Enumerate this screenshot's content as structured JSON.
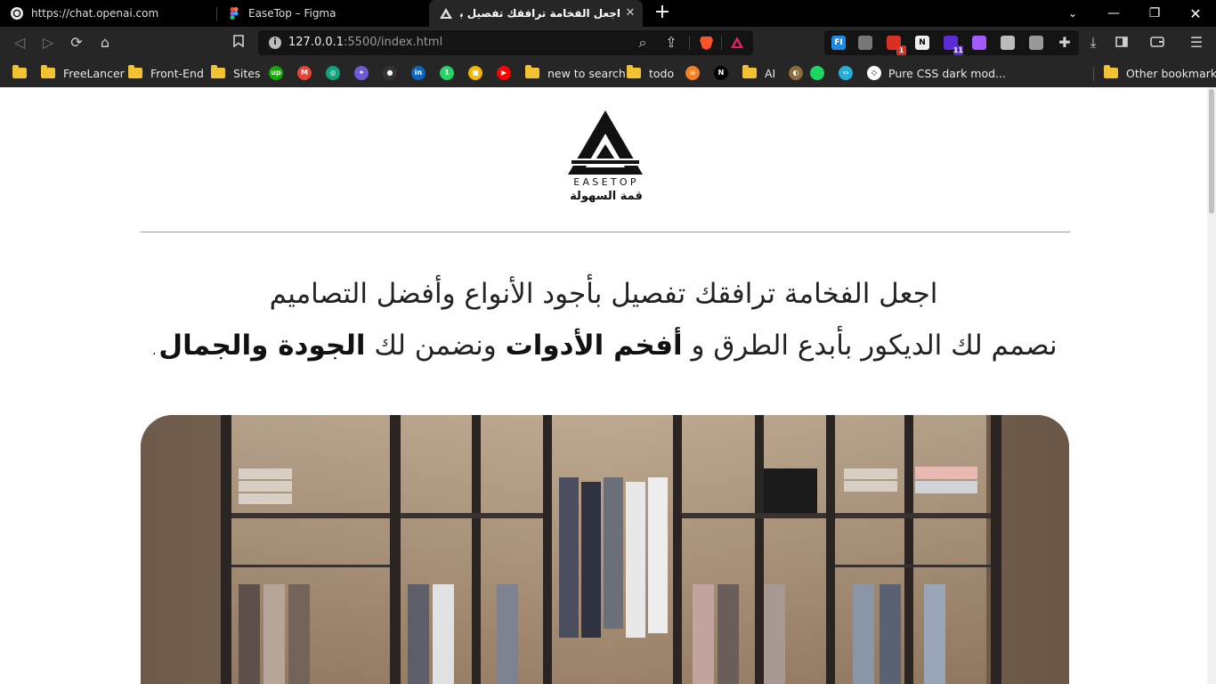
{
  "browser": {
    "tabs": [
      {
        "title": "https://chat.openai.com",
        "active": false,
        "icon": "openai-icon"
      },
      {
        "title": "EaseTop – Figma",
        "active": false,
        "icon": "figma-icon"
      },
      {
        "title": "اجعل الفخامة ترافقك تفصيل بأجود الأ",
        "active": true,
        "icon": "easetop-icon"
      }
    ],
    "address": {
      "url_host": "127.0.0.1",
      "url_rest": ":5500/index.html"
    },
    "extensions": [
      {
        "name": "fi-extension-icon",
        "color": "#1e88e5",
        "label": "FI"
      },
      {
        "name": "grammar-extension-icon",
        "color": "#777777",
        "label": ""
      },
      {
        "name": "gmail-extension-icon",
        "color": "#d93025",
        "label": "",
        "badge": "1"
      },
      {
        "name": "notion-extension-icon",
        "color": "#eeeeee",
        "label": "N"
      },
      {
        "name": "cloud-extension-icon",
        "color": "#5b2bd6",
        "label": "",
        "badge": "11"
      },
      {
        "name": "purple-extension-icon",
        "color": "#a259ff",
        "label": ""
      },
      {
        "name": "pen-extension-icon",
        "color": "#bbbbbb",
        "label": ""
      },
      {
        "name": "globe-extension-icon",
        "color": "#999999",
        "label": ""
      }
    ],
    "bookmarks": [
      {
        "label": "",
        "type": "folder"
      },
      {
        "label": "FreeLancer",
        "type": "folder"
      },
      {
        "label": "Front-End",
        "type": "folder"
      },
      {
        "label": "Sites",
        "type": "folder"
      },
      {
        "label": "",
        "type": "site",
        "icon": "upwork-icon",
        "color": "#14a800",
        "glyph": "up"
      },
      {
        "label": "",
        "type": "site",
        "icon": "gmail-icon",
        "color": "#ea4335",
        "glyph": "M"
      },
      {
        "label": "",
        "type": "site",
        "icon": "chatgpt-icon",
        "color": "#10a37f",
        "glyph": "◎"
      },
      {
        "label": "",
        "type": "site",
        "icon": "gemini-icon",
        "color": "#6f5bd8",
        "glyph": "✦"
      },
      {
        "label": "",
        "type": "site",
        "icon": "github-icon",
        "color": "#333333",
        "glyph": "●"
      },
      {
        "label": "",
        "type": "site",
        "icon": "linkedin-icon",
        "color": "#0a66c2",
        "glyph": "in"
      },
      {
        "label": "",
        "type": "site",
        "icon": "whatsapp-icon",
        "color": "#25d366",
        "glyph": "1"
      },
      {
        "label": "",
        "type": "site",
        "icon": "keep-icon",
        "color": "#f4b400",
        "glyph": "■"
      },
      {
        "label": "",
        "type": "site",
        "icon": "youtube-icon",
        "color": "#ff0000",
        "glyph": "▶"
      },
      {
        "label": "new to search",
        "type": "folder"
      },
      {
        "label": "todo",
        "type": "folder"
      },
      {
        "label": "",
        "type": "site",
        "icon": "stack-icon",
        "color": "#f48024",
        "glyph": "≡"
      },
      {
        "label": "",
        "type": "site",
        "icon": "next-icon",
        "color": "#000000",
        "glyph": "N"
      },
      {
        "label": "AI",
        "type": "folder"
      },
      {
        "label": "",
        "type": "site",
        "icon": "map-icon",
        "color": "#8a6d3b",
        "glyph": "◐"
      },
      {
        "label": "",
        "type": "site",
        "icon": "green-dot-icon",
        "color": "#1ed760",
        "glyph": ""
      },
      {
        "label": "",
        "type": "site",
        "icon": "code-icon",
        "color": "#26b0d9",
        "glyph": "‹›"
      },
      {
        "label": "Pure CSS dark mod...",
        "type": "site",
        "icon": "codepen-icon",
        "color": "#ffffff",
        "glyph": "◇"
      }
    ],
    "other_bookmarks": "Other bookmarks"
  },
  "page": {
    "brand_name": "EASETOP",
    "brand_tagline": "قمة السهولة",
    "headline_1": "اجعل الفخامة ترافقك تفصيل بأجود الأنواع وأفضل التصاميم",
    "headline_2_part1": "نصمم لك الديكور بأبدع الطرق و ",
    "headline_2_bold1": "أفخم الأدوات",
    "headline_2_part2": " ونضمن لك ",
    "headline_2_bold2": "الجودة والجمال",
    "headline_2_end": "."
  },
  "colors": {
    "chrome_dark": "#000000",
    "toolbar": "#262626",
    "folder": "#f2c232",
    "text": "#222222"
  }
}
